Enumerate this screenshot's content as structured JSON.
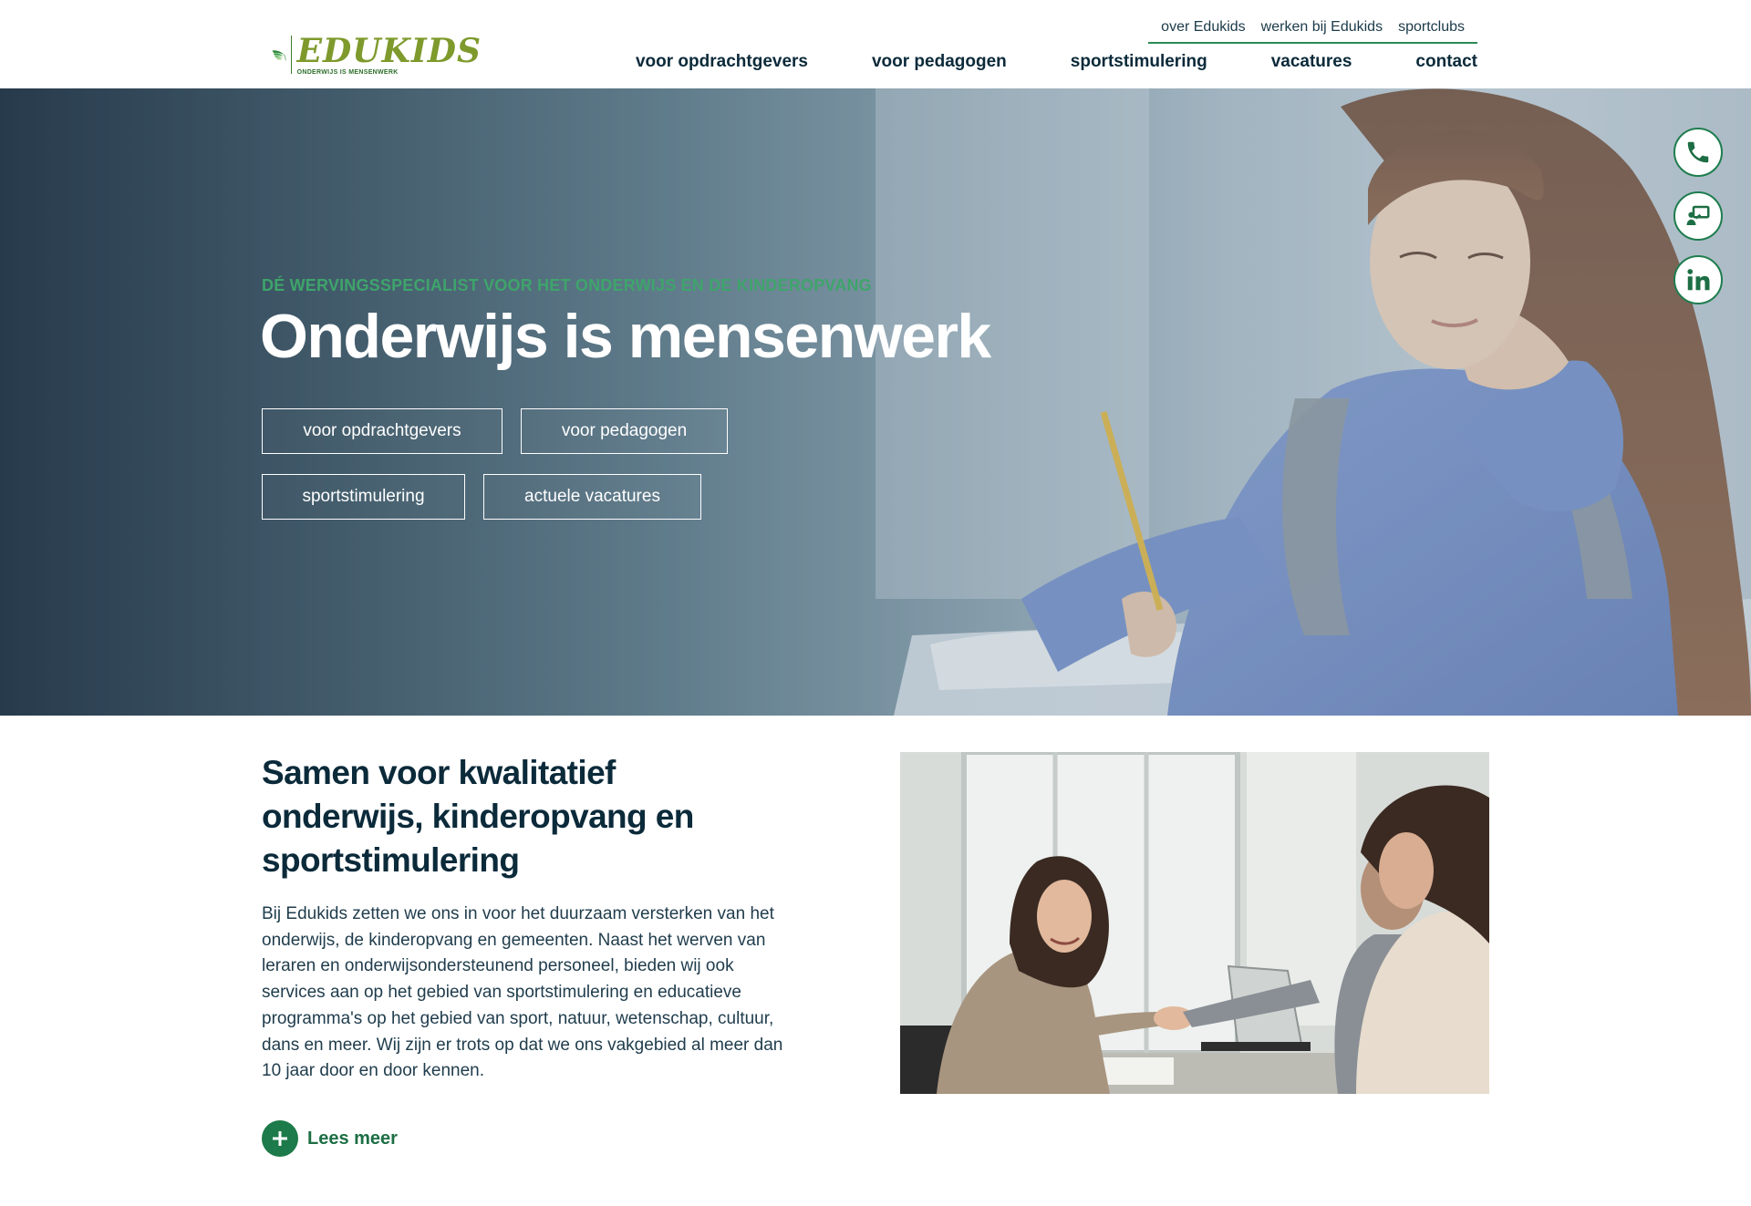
{
  "logo": {
    "title": "EDUKIDS",
    "tagline": "ONDERWIJS IS MENSENWERK"
  },
  "topnav": [
    "over Edukids",
    "werken bij Edukids",
    "sportclubs"
  ],
  "mainnav": [
    "voor opdrachtgevers",
    "voor pedagogen",
    "sportstimulering",
    "vacatures",
    "contact"
  ],
  "hero": {
    "kicker": "DÉ WERVINGSSPECIALIST VOOR HET ONDERWIJS EN DE KINDEROPVANG",
    "title": "Onderwijs is mensenwerk",
    "buttons": [
      "voor opdrachtgevers",
      "voor pedagogen",
      "sportstimulering",
      "actuele vacatures"
    ]
  },
  "side_icons": [
    "phone-icon",
    "presentation-icon",
    "linkedin-icon"
  ],
  "section": {
    "title": "Samen voor kwalitatief onderwijs, kinderopvang en sportstimulering",
    "body": "Bij Edukids zetten we ons in voor het duurzaam versterken van het onderwijs, de kinderopvang en gemeenten. Naast het werven van leraren en onderwijsondersteunend personeel, bieden wij ook services aan op het gebied van sportstimulering en educatieve programma's op het gebied van sport, natuur, wetenschap, cultuur, dans en meer. Wij zijn er trots op dat we ons vakgebied al meer dan 10 jaar door en door kennen.",
    "read_more": "Lees meer"
  },
  "colors": {
    "brand_green": "#1d7a4a",
    "accent_green": "#3ea46b",
    "navy": "#0b2a3a",
    "logo_olive": "#7e9a2c"
  }
}
